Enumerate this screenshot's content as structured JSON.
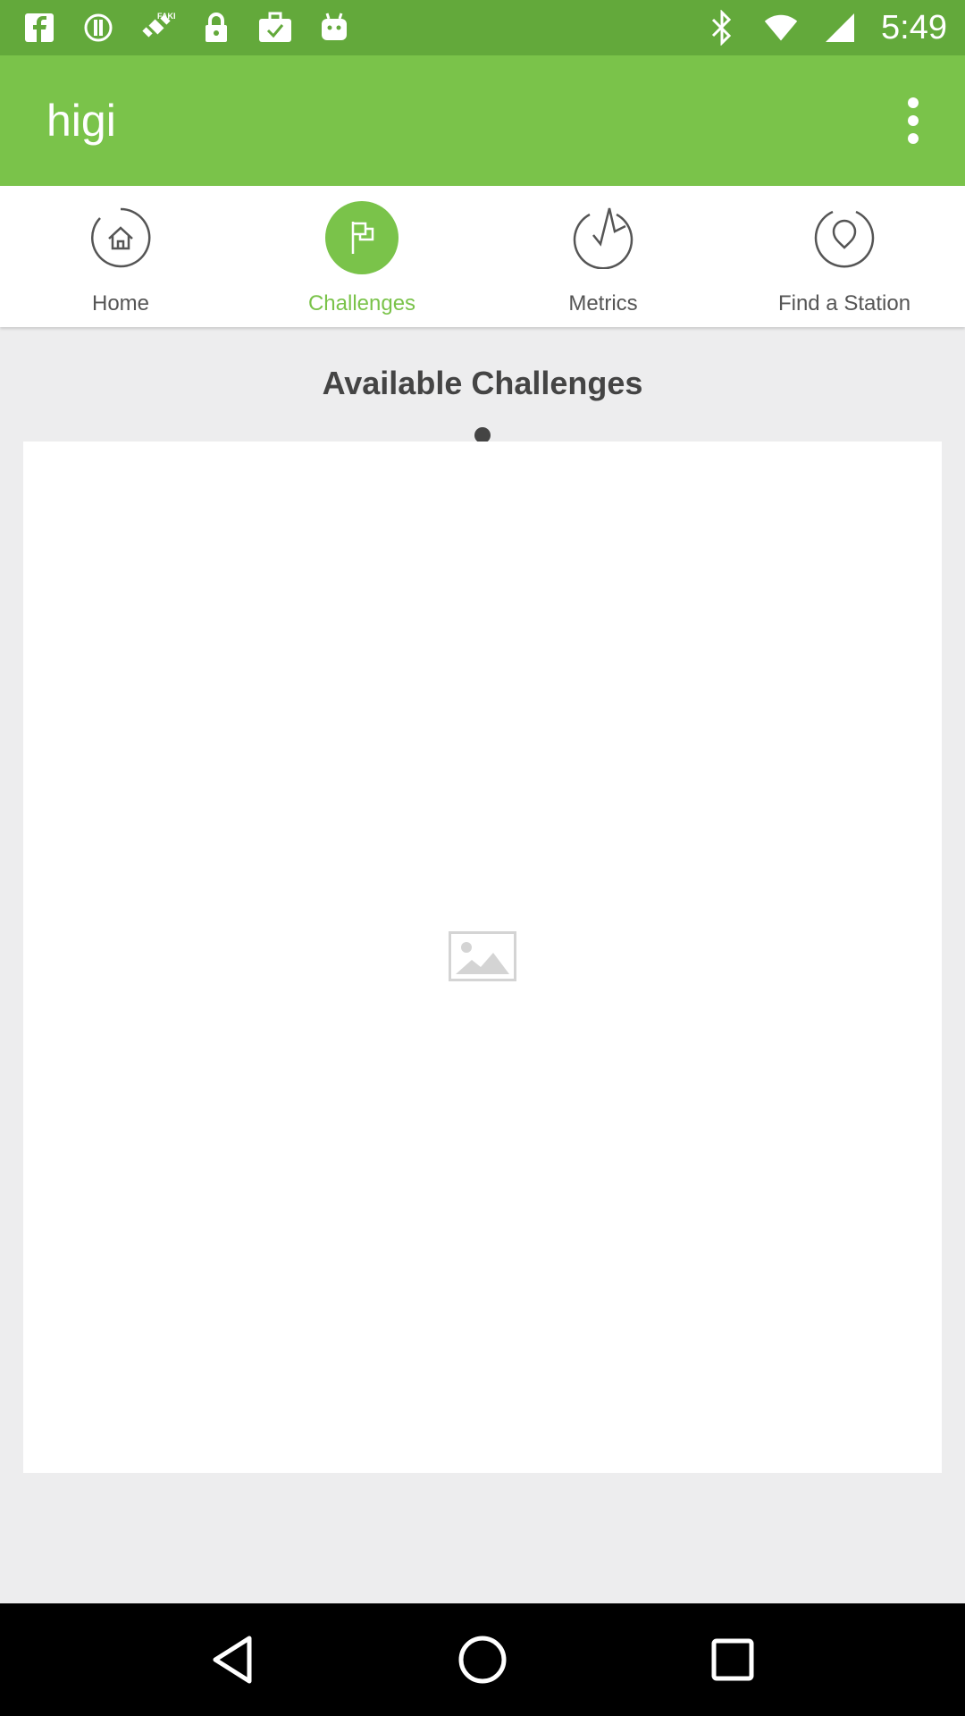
{
  "status_bar": {
    "time": "5:49",
    "left_icons": [
      "facebook-icon",
      "circle-exclaim-icon",
      "satellite-fake-icon",
      "lock-icon",
      "briefcase-check-icon",
      "android-icon"
    ],
    "right_icons": [
      "bluetooth-icon",
      "wifi-icon",
      "signal-icon"
    ]
  },
  "app_bar": {
    "title": "higi",
    "menu_icon": "more-vert-icon",
    "color": "#7ac34a"
  },
  "tabs": [
    {
      "label": "Home",
      "icon": "home-icon",
      "active": false
    },
    {
      "label": "Challenges",
      "icon": "flag-icon",
      "active": true
    },
    {
      "label": "Metrics",
      "icon": "pulse-icon",
      "active": false
    },
    {
      "label": "Find a Station",
      "icon": "location-icon",
      "active": false
    }
  ],
  "main": {
    "section_title": "Available Challenges"
  },
  "nav_bar": {
    "buttons": [
      "back-icon",
      "home-circle-icon",
      "recents-icon"
    ]
  }
}
